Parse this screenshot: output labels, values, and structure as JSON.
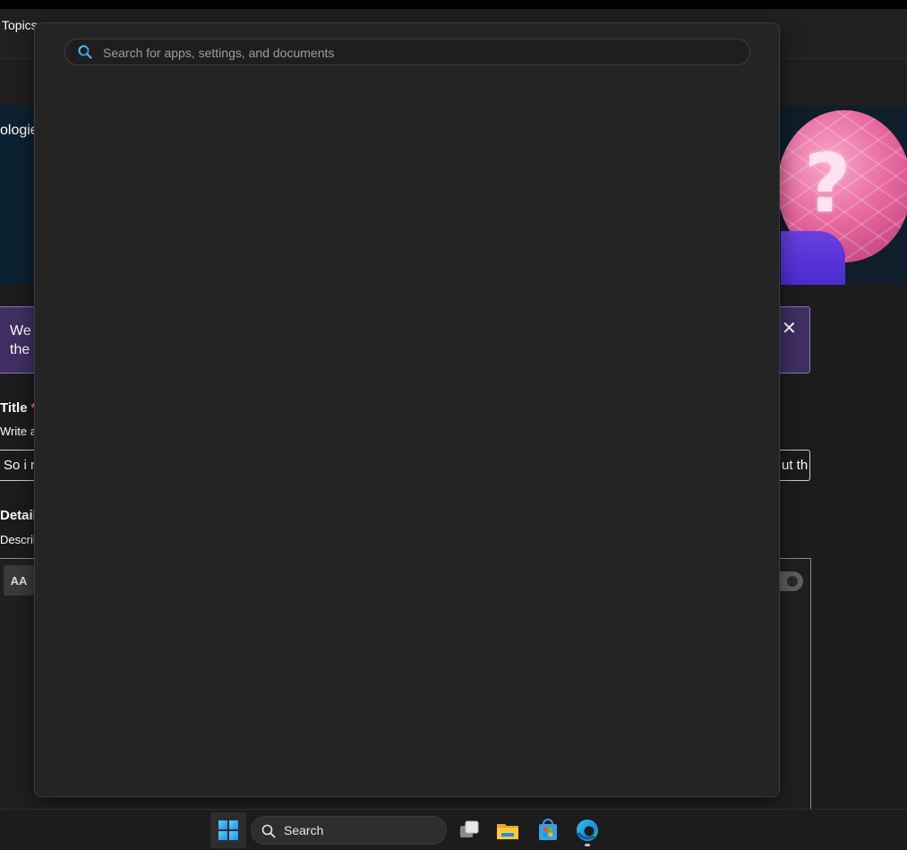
{
  "background_page": {
    "nav": {
      "topics_label": "Topics"
    },
    "hero": {
      "text_fragment": "ologies"
    },
    "banner": {
      "text": "We\nthe",
      "close_glyph": "✕"
    },
    "form": {
      "title_label": "Title",
      "required_mark": "*",
      "title_hint": "Write a",
      "title_value_start": "So i r",
      "title_value_end": "ut th",
      "details_label": "Details",
      "details_hint": "Describ",
      "text_format_button": "AA"
    }
  },
  "search_panel": {
    "placeholder": "Search for apps, settings, and documents",
    "value": ""
  },
  "taskbar": {
    "search_label": "Search",
    "icons": [
      "windows-start-icon",
      "search-icon",
      "task-view-icon",
      "file-explorer-icon",
      "microsoft-store-icon",
      "edge-icon"
    ]
  },
  "colors": {
    "panel_bg": "#242424",
    "banner_bg": "#3f2f63",
    "banner_border": "#8b73c7",
    "required": "#ff6a6a",
    "taskbar_bg": "#1c1c1c"
  }
}
